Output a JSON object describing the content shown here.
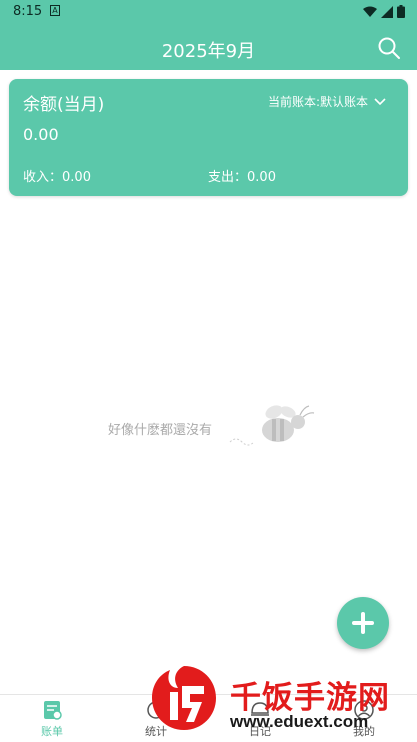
{
  "status_bar": {
    "time": "8:15",
    "notification_glyph": "A"
  },
  "app_bar": {
    "title": "2025年9月",
    "search_icon": "search-icon"
  },
  "summary_card": {
    "balance_label": "余额(当月)",
    "book_label": "当前账本:默认账本",
    "balance_value": "0.00",
    "income_label": "收入：",
    "income_value": "0.00",
    "expense_label": "支出：",
    "expense_value": "0.00"
  },
  "empty_state": {
    "message": "好像什麽都還沒有"
  },
  "fab": {
    "icon": "plus-icon"
  },
  "bottom_nav": {
    "items": [
      {
        "label": "账单",
        "icon": "bill-icon",
        "active": true
      },
      {
        "label": "统计",
        "icon": "stats-icon",
        "active": false
      },
      {
        "label": "日记",
        "icon": "diary-icon",
        "active": false
      },
      {
        "label": "我的",
        "icon": "profile-icon",
        "active": false
      }
    ]
  },
  "watermark": {
    "name": "千饭手游网",
    "url": "www.eduext.com"
  },
  "colors": {
    "accent": "#5bc8aa",
    "watermark_red": "#e21c1c"
  }
}
